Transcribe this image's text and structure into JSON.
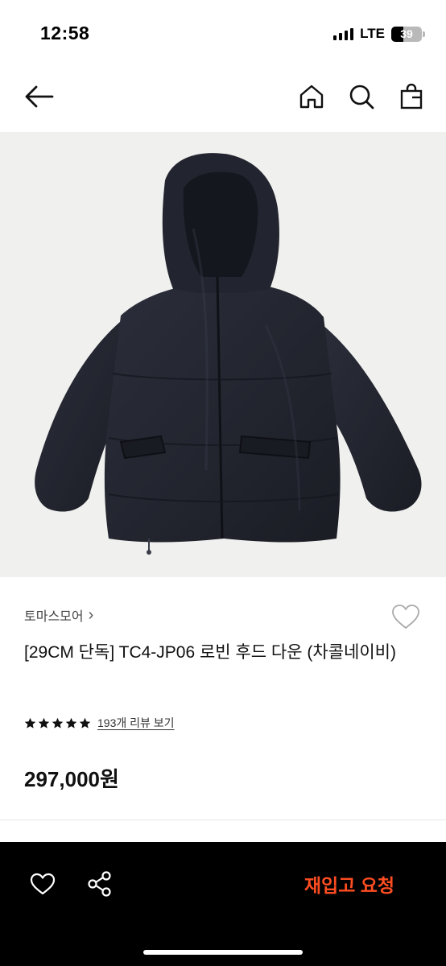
{
  "status_bar": {
    "time": "12:58",
    "network": "LTE",
    "battery_level": "39",
    "battery_fraction": 0.39
  },
  "nav": {
    "back_icon": "arrow-left-icon",
    "home_icon": "home-icon",
    "search_icon": "search-icon",
    "bag_icon": "shopping-bag-icon"
  },
  "product": {
    "image_alt_icon": "puffer-jacket-image",
    "brand": "토마스모어",
    "brand_chevron": "›",
    "title": "[29CM 단독] TC4-JP06 로빈 후드 다운 (차콜네이비)",
    "rating_stars": 5,
    "review_link": "193개 리뷰 보기",
    "price": "297,000원",
    "wishlist_icon": "heart-outline-icon"
  },
  "bottom_bar": {
    "like_icon": "heart-outline-icon",
    "share_icon": "share-icon",
    "restock_label": "재입고 요청"
  },
  "colors": {
    "accent": "#ff4d22",
    "bottom_bar_bg": "#000000",
    "image_bg": "#f0f0ee",
    "jacket": "#23252f"
  }
}
